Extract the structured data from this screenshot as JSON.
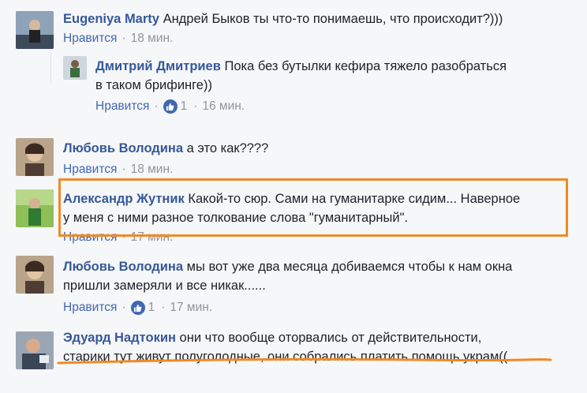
{
  "comments": [
    {
      "name": "Eugeniya Marty",
      "text": "Андрей Быков ты что-то понимаешь, что происходит?)))",
      "like": "Нравится",
      "time": "18 мин."
    },
    {
      "name": "Дмитрий Дмитриев",
      "text_line1": "Пока без бутылки кефира тяжело разобраться",
      "text_line2": "в таком брифинге))",
      "like": "Нравится",
      "likes": "1",
      "time": "16 мин."
    },
    {
      "name": "Любовь Володина",
      "text": "а это как????",
      "like": "Нравится",
      "time": "18 мин."
    },
    {
      "name": "Александр Жутник",
      "text_line1": "Какой-то сюр. Сами на гуманитарке сидим... Наверное",
      "text_line2": "у меня с ними разное толкование слова \"гуманитарный\".",
      "like": "Нравится",
      "time": "17 мин."
    },
    {
      "name": "Любовь Володина",
      "text_line1": "мы вот уже два месяца добиваемся чтобы к нам окна",
      "text_line2": "пришли замеряли и все никак......",
      "like": "Нравится",
      "likes": "1",
      "time": "17 мин."
    },
    {
      "name": "Эдуард Надтокин",
      "text_line1": "они что вообще оторвались от действительности,",
      "text_line2": "старики тут живут полуголодные, они собрались платить помощь украм(("
    }
  ],
  "colors": {
    "name": "#365899",
    "highlight": "#f08a24",
    "like_badge": "#4267b2"
  }
}
